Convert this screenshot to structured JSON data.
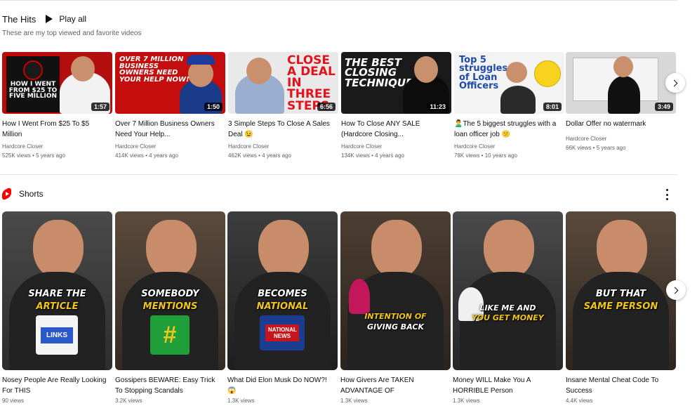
{
  "section": {
    "title": "The Hits",
    "play_all": "Play all",
    "description": "These are my top viewed and favorite videos"
  },
  "videos": [
    {
      "title": "How I Went From $25 To $5 Million",
      "channel": "Hardcore Closer",
      "meta": "525K views • 5 years ago",
      "duration": "1:57",
      "thumb_text": "HOW I WENT FROM $25 TO FIVE MILLION"
    },
    {
      "title": "Over 7 Million Business Owners Need Your Help...",
      "channel": "Hardcore Closer",
      "meta": "414K views • 4 years ago",
      "duration": "1:50",
      "thumb_text": "OVER 7 MILLION BUSINESS OWNERS NEED YOUR HELP NOW!"
    },
    {
      "title": "3 Simple Steps To Close A Sales Deal 😉",
      "channel": "Hardcore Closer",
      "meta": "462K views • 4 years ago",
      "duration": "6:56",
      "thumb_text": "CLOSE A DEAL IN THREE STEPS"
    },
    {
      "title": "How To Close ANY SALE (Hardcore Closing...",
      "channel": "Hardcore Closer",
      "meta": "134K views • 4 years ago",
      "duration": "11:23",
      "thumb_text": "THE BEST CLOSING TECHNIQUES"
    },
    {
      "title": "🙎‍♂️The 5 biggest struggles with a loan officer job 😕",
      "channel": "Hardcore Closer",
      "meta": "78K views • 10 years ago",
      "duration": "8:01",
      "thumb_text": "Top 5 struggles of Loan Officers"
    },
    {
      "title": "Dollar Offer no watermark",
      "channel": "Hardcore Closer",
      "meta": "66K views • 5 years ago",
      "duration": "3:49",
      "thumb_text": ""
    }
  ],
  "shorts": {
    "title": "Shorts",
    "items": [
      {
        "title": "Nosey People Are Really Looking For THIS",
        "views": "90 views",
        "cap1": "SHARE THE",
        "cap2": "ARTICLE",
        "badge": "LINKS"
      },
      {
        "title": "Gossipers BEWARE: Easy Trick To Stopping Scandals",
        "views": "3.2K views",
        "cap1": "SOMEBODY",
        "cap2": "MENTIONS",
        "badge": "#"
      },
      {
        "title": "What Did Elon Musk Do NOW?! 😱",
        "views": "1.3K views",
        "cap1": "BECOMES",
        "cap2": "NATIONAL",
        "badge": "NATIONAL NEWS"
      },
      {
        "title": "How Givers Are TAKEN ADVANTAGE OF",
        "views": "1.3K views",
        "cap1": "INTENTION OF",
        "cap2": "GIVING BACK",
        "badge": ""
      },
      {
        "title": "Money WILL Make You A HORRIBLE Person",
        "views": "1.3K views",
        "cap1": "LIKE ME AND",
        "cap2": "YOU GET MONEY",
        "badge": ""
      },
      {
        "title": "Insane Mental Cheat Code To Success",
        "views": "4.4K views",
        "cap1": "BUT THAT",
        "cap2": "SAME PERSON",
        "badge": ""
      }
    ]
  }
}
